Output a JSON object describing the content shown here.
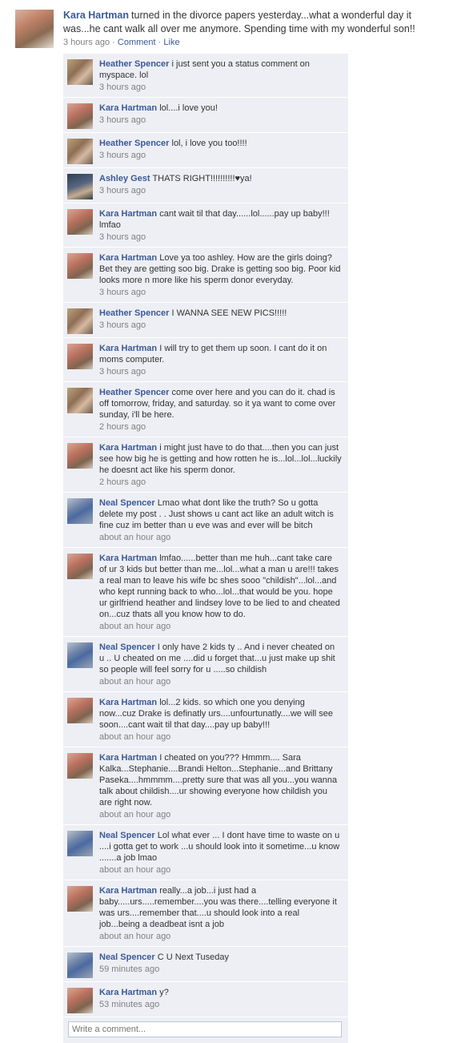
{
  "post": {
    "author": "Kara Hartman",
    "text": "turned in the divorce papers yesterday...what a wonderful day it was...he cant walk all over me anymore. Spending time with my wonderful son!!",
    "time": "3 hours ago",
    "separator1": "·",
    "comment_link": "Comment",
    "separator2": "·",
    "like_link": "Like"
  },
  "comments": [
    {
      "author": "Heather Spencer",
      "avatar": "heather",
      "text": "i just sent you a status comment on myspace. lol",
      "time": "3 hours ago"
    },
    {
      "author": "Kara Hartman",
      "avatar": "kara",
      "text": "lol....i love you!",
      "time": "3 hours ago"
    },
    {
      "author": "Heather Spencer",
      "avatar": "heather",
      "text": "lol, i love you too!!!!",
      "time": "3 hours ago"
    },
    {
      "author": "Ashley Gest",
      "avatar": "ashley",
      "text": "THATS RIGHT!!!!!!!!!!♥ya!",
      "time": "3 hours ago"
    },
    {
      "author": "Kara Hartman",
      "avatar": "kara",
      "text": "cant wait til that day......lol......pay up baby!!! lmfao",
      "time": "3 hours ago"
    },
    {
      "author": "Kara Hartman",
      "avatar": "kara",
      "text": "Love ya too ashley. How are the girls doing? Bet they are getting soo big. Drake is getting soo big. Poor kid looks more n more like his sperm donor everyday.",
      "time": "3 hours ago"
    },
    {
      "author": "Heather Spencer",
      "avatar": "heather",
      "text": "I WANNA SEE NEW PICS!!!!!",
      "time": "3 hours ago"
    },
    {
      "author": "Kara Hartman",
      "avatar": "kara",
      "text": "I will try to get them up soon. I cant do it on moms computer.",
      "time": "3 hours ago"
    },
    {
      "author": "Heather Spencer",
      "avatar": "heather",
      "text": "come over here and you can do it. chad is off tomorrow, friday, and saturday. so it ya want to come over sunday, i'll be here.",
      "time": "2 hours ago"
    },
    {
      "author": "Kara Hartman",
      "avatar": "kara",
      "text": "i might just have to do that....then you can just see how big he is getting and how rotten he is...lol...lol...luckily he doesnt act like his sperm donor.",
      "time": "2 hours ago"
    },
    {
      "author": "Neal Spencer",
      "avatar": "neal",
      "text": "Lmao what dont like the truth? So u gotta delete my post . . Just shows u cant act like an adult witch is fine cuz im better than u eve was and ever will be bitch",
      "time": "about an hour ago"
    },
    {
      "author": "Kara Hartman",
      "avatar": "kara",
      "text": "lmfao......better than me huh...cant take care of ur 3 kids but better than me...lol...what a man u are!!! takes a real man to leave his wife bc shes sooo \"childish\"...lol...and who kept running back to who...lol...that would be you. hope ur girlfriend heather and lindsey love to be lied to and cheated on...cuz thats all you know how to do.",
      "time": "about an hour ago"
    },
    {
      "author": "Neal Spencer",
      "avatar": "neal",
      "text": "I only have 2 kids ty .. And i never cheated on u .. U cheated on me ....did u forget that...u just make up shit so people will feel sorry for u .....so childish",
      "time": "about an hour ago"
    },
    {
      "author": "Kara Hartman",
      "avatar": "kara",
      "text": "lol...2 kids. so which one you denying now...cuz Drake is definatly urs....unfourtunatly....we will see soon....cant wait til that day....pay up baby!!!",
      "time": "about an hour ago"
    },
    {
      "author": "Kara Hartman",
      "avatar": "kara",
      "text": "I cheated on you??? Hmmm.... Sara Kalka...Stephanie....Brandi Helton...Stephanie...and Brittany Paseka....hmmmm....pretty sure that was all you...you wanna talk about childish....ur showing everyone how childish you are right now.",
      "time": "about an hour ago"
    },
    {
      "author": "Neal Spencer",
      "avatar": "neal",
      "text": "Lol what ever ... I dont have time to waste on u ....i gotta get to work ...u should look into it sometime...u know .......a job lmao",
      "time": "about an hour ago"
    },
    {
      "author": "Kara Hartman",
      "avatar": "kara",
      "text": "really...a job...i just had a baby.....urs.....remember....you was there....telling everyone it was urs....remember that....u should look into a real job...being a deadbeat isnt a job",
      "time": "about an hour ago"
    },
    {
      "author": "Neal Spencer",
      "avatar": "neal",
      "text": "C U Next Tuseday",
      "time": "59 minutes ago"
    },
    {
      "author": "Kara Hartman",
      "avatar": "kara",
      "text": "y?",
      "time": "53 minutes ago"
    }
  ],
  "write_comment": {
    "placeholder": "Write a comment..."
  }
}
